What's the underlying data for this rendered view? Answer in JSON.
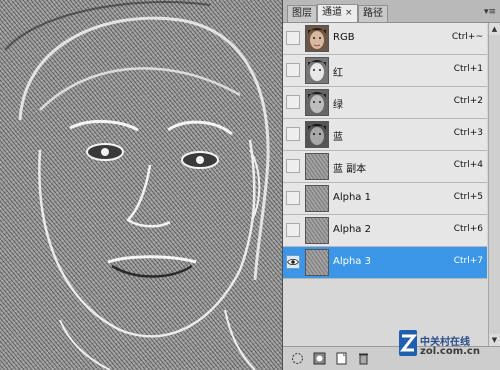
{
  "tabs": [
    {
      "label": "图层",
      "active": false
    },
    {
      "label": "通道",
      "active": true,
      "close": "×"
    },
    {
      "label": "路径",
      "active": false
    }
  ],
  "channels": [
    {
      "name": "RGB",
      "shortcut": "Ctrl+~",
      "visible": false,
      "thumb": "color"
    },
    {
      "name": "红",
      "shortcut": "Ctrl+1",
      "visible": false,
      "thumb": "gray-light"
    },
    {
      "name": "绿",
      "shortcut": "Ctrl+2",
      "visible": false,
      "thumb": "gray"
    },
    {
      "name": "蓝",
      "shortcut": "Ctrl+3",
      "visible": false,
      "thumb": "gray-dark"
    },
    {
      "name": "蓝 副本",
      "shortcut": "Ctrl+4",
      "visible": false,
      "thumb": "texture"
    },
    {
      "name": "Alpha 1",
      "shortcut": "Ctrl+5",
      "visible": false,
      "thumb": "texture"
    },
    {
      "name": "Alpha 2",
      "shortcut": "Ctrl+6",
      "visible": false,
      "thumb": "texture"
    },
    {
      "name": "Alpha 3",
      "shortcut": "Ctrl+7",
      "visible": true,
      "thumb": "texture",
      "selected": true
    }
  ],
  "watermark": {
    "cn": "中关村在线",
    "en": "zol.com.cn"
  },
  "colors": {
    "selection": "#3c96e8",
    "panel": "#d6d6d6"
  }
}
